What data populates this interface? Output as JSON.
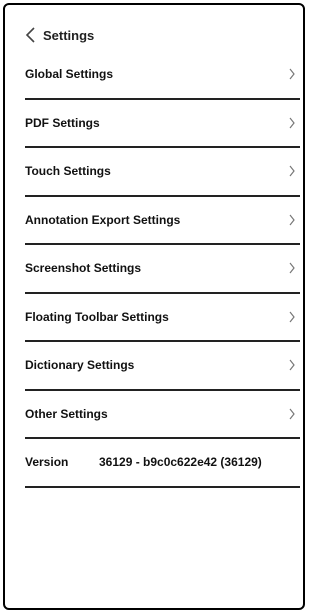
{
  "header": {
    "back_label": "Settings",
    "back_icon": "chevron-left-icon"
  },
  "items": [
    {
      "label": "Global Settings"
    },
    {
      "label": "PDF Settings"
    },
    {
      "label": "Touch Settings"
    },
    {
      "label": "Annotation Export Settings"
    },
    {
      "label": "Screenshot Settings"
    },
    {
      "label": "Floating Toolbar Settings"
    },
    {
      "label": "Dictionary Settings"
    },
    {
      "label": "Other Settings"
    }
  ],
  "version": {
    "label": "Version",
    "value": "36129 - b9c0c622e42 (36129)"
  },
  "colors": {
    "border": "#222222",
    "text": "#111111",
    "background": "#ffffff"
  }
}
